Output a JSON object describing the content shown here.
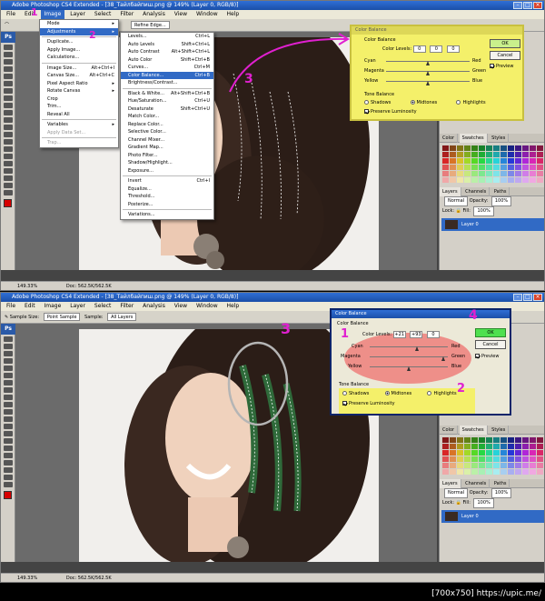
{
  "top": {
    "window_title": "Adobe Photoshop CS4 Extended - [38_Тайлбайпиш.png @ 149% (Layer 0, RGB/8)]",
    "menu": [
      "File",
      "Edit",
      "Image",
      "Layer",
      "Select",
      "Filter",
      "Analysis",
      "View",
      "Window",
      "Help"
    ],
    "options_button": "Refine Edge...",
    "image_menu": [
      {
        "label": "Mode",
        "key": ""
      },
      {
        "label": "Adjustments",
        "key": ""
      },
      {
        "label": "Duplicate...",
        "key": ""
      },
      {
        "label": "Apply Image...",
        "key": ""
      },
      {
        "label": "Calculations...",
        "key": ""
      },
      {
        "label": "Image Size...",
        "key": "Alt+Ctrl+I"
      },
      {
        "label": "Canvas Size...",
        "key": "Alt+Ctrl+C"
      },
      {
        "label": "Pixel Aspect Ratio",
        "key": ""
      },
      {
        "label": "Rotate Canvas",
        "key": ""
      },
      {
        "label": "Crop",
        "key": ""
      },
      {
        "label": "Trim...",
        "key": ""
      },
      {
        "label": "Reveal All",
        "key": ""
      },
      {
        "label": "Variables",
        "key": ""
      },
      {
        "label": "Apply Data Set...",
        "key": ""
      },
      {
        "label": "Trap...",
        "key": ""
      }
    ],
    "adjust_menu": [
      {
        "label": "Levels...",
        "key": "Ctrl+L"
      },
      {
        "label": "Auto Levels",
        "key": "Shift+Ctrl+L"
      },
      {
        "label": "Auto Contrast",
        "key": "Alt+Shift+Ctrl+L"
      },
      {
        "label": "Auto Color",
        "key": "Shift+Ctrl+B"
      },
      {
        "label": "Curves...",
        "key": "Ctrl+M"
      },
      {
        "label": "Color Balance...",
        "key": "Ctrl+B"
      },
      {
        "label": "Brightness/Contrast...",
        "key": ""
      },
      {
        "label": "Black & White...",
        "key": "Alt+Shift+Ctrl+B"
      },
      {
        "label": "Hue/Saturation...",
        "key": "Ctrl+U"
      },
      {
        "label": "Desaturate",
        "key": "Shift+Ctrl+U"
      },
      {
        "label": "Match Color...",
        "key": ""
      },
      {
        "label": "Replace Color...",
        "key": ""
      },
      {
        "label": "Selective Color...",
        "key": ""
      },
      {
        "label": "Channel Mixer...",
        "key": ""
      },
      {
        "label": "Gradient Map...",
        "key": ""
      },
      {
        "label": "Photo Filter...",
        "key": ""
      },
      {
        "label": "Shadow/Highlight...",
        "key": ""
      },
      {
        "label": "Exposure...",
        "key": ""
      },
      {
        "label": "Invert",
        "key": "Ctrl+I"
      },
      {
        "label": "Equalize...",
        "key": ""
      },
      {
        "label": "Threshold...",
        "key": ""
      },
      {
        "label": "Posterize...",
        "key": ""
      },
      {
        "label": "Variations...",
        "key": ""
      }
    ],
    "dialog": {
      "title": "Color Balance",
      "group": "Color Balance",
      "levels_label": "Color Levels:",
      "levels": [
        "0",
        "0",
        "0"
      ],
      "cyan": "Cyan",
      "red": "Red",
      "magenta": "Magenta",
      "green": "Green",
      "yellow": "Yellow",
      "blue": "Blue",
      "tone": "Tone Balance",
      "shadows": "Shadows",
      "midtones": "Midtones",
      "highlights": "Highlights",
      "preserve": "Preserve Luminosity",
      "ok": "OK",
      "cancel": "Cancel",
      "preview": "Preview"
    },
    "status": [
      "149.33%",
      "Doc: 562.5K/562.5K"
    ],
    "panel_tabs": [
      "Color",
      "Swatches",
      "Styles"
    ],
    "layer_tabs": [
      "Layers",
      "Channels",
      "Paths"
    ],
    "blend": "Normal",
    "opacity_label": "Opacity:",
    "opacity": "100%",
    "lock": "Lock:",
    "fill_label": "Fill:",
    "fill": "100%",
    "layer_name": "Layer 0",
    "annotations": [
      "1",
      "2",
      "3"
    ]
  },
  "bottom": {
    "window_title": "Adobe Photoshop CS4 Extended - [38_Тайлбайпиш.png @ 149% (Layer 0, RGB/8)]",
    "menu": [
      "File",
      "Edit",
      "Image",
      "Layer",
      "Select",
      "Filter",
      "Analysis",
      "View",
      "Window",
      "Help"
    ],
    "sample_size_label": "Sample Size:",
    "sample_size": "Point Sample",
    "sample_label": "Sample:",
    "sample": "All Layers",
    "dialog": {
      "title": "Color Balance",
      "group": "Color Balance",
      "levels_label": "Color Levels:",
      "levels": [
        "+21",
        "+93",
        "0"
      ],
      "cyan": "Cyan",
      "red": "Red",
      "magenta": "Magenta",
      "green": "Green",
      "yellow": "Yellow",
      "blue": "Blue",
      "tone": "Tone Balance",
      "shadows": "Shadows",
      "midtones": "Midtones",
      "highlights": "Highlights",
      "preserve": "Preserve Luminosity",
      "ok": "OK",
      "cancel": "Cancel",
      "preview": "Preview"
    },
    "status": [
      "149.33%",
      "Doc: 562.5K/562.5K"
    ],
    "panel_tabs": [
      "Color",
      "Swatches",
      "Styles"
    ],
    "layer_tabs": [
      "Layers",
      "Channels",
      "Paths"
    ],
    "blend": "Normal",
    "opacity_label": "Opacity:",
    "opacity": "100%",
    "lock": "Lock:",
    "fill_label": "Fill:",
    "fill": "100%",
    "layer_name": "Layer 0",
    "annotations": [
      "1",
      "2",
      "3",
      "4"
    ]
  },
  "footer": "[700x750] https://upic.me/",
  "colors": {
    "highlight_yellow": "#f4f06a",
    "annot_magenta": "#e020d0",
    "ok_green": "#4fe04f",
    "ellipse_red": "#f06060",
    "menu_select": "#316ac5"
  }
}
